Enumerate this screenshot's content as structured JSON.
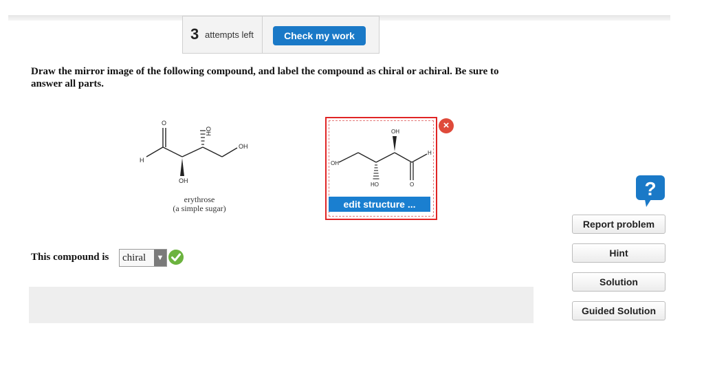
{
  "attempts": {
    "count": "3",
    "label": "attempts left"
  },
  "check_button": "Check my work",
  "question": "Draw the mirror image of the following compound, and label the compound as chiral or achiral. Be sure to answer all parts.",
  "molecule": {
    "name": "erythrose",
    "subtitle": "(a simple sugar)",
    "atoms": {
      "O": "O",
      "H": "H",
      "OH": "OH"
    }
  },
  "mirror": {
    "edit_label": "edit structure ...",
    "close_symbol": "×",
    "atoms": {
      "OH": "OH",
      "HO": "HO",
      "H": "H",
      "O": "O"
    }
  },
  "compound_statement": "This compound is",
  "chirality_select": {
    "value": "chiral",
    "arrow": "▼"
  },
  "sidebar_buttons": [
    "Report problem",
    "Hint",
    "Solution",
    "Guided Solution"
  ],
  "help": {
    "symbol": "?",
    "color": "#1a79c7"
  },
  "colors": {
    "accent": "#1a79c7",
    "correct": "#6cb33f",
    "error": "#e02424"
  }
}
